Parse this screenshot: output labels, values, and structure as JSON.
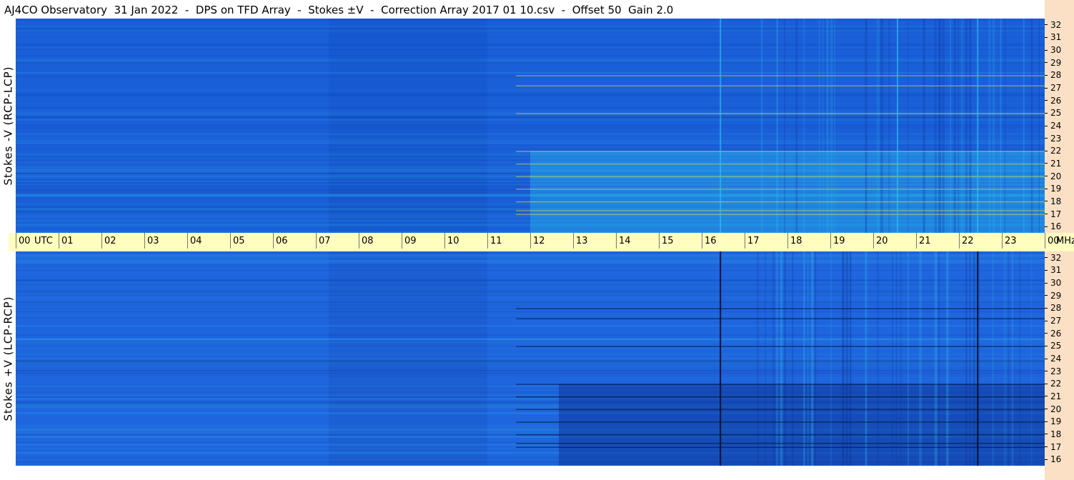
{
  "window": {
    "title": "AJ4CO Observatory  31 Jan 2022  -  DPS on TFD Array  -  Stokes ±V  -  Correction Array 2017 01 10.csv  -  Offset 50  Gain 2.0"
  },
  "chart_data": [
    {
      "type": "heatmap",
      "title": "",
      "ylabel": "Stokes -V (RCP-LCP)",
      "x_unit": "UTC",
      "y_unit": "MHz",
      "xlim": [
        0,
        24
      ],
      "ylim": [
        15.5,
        32.5
      ],
      "x_ticks": [
        "00",
        "01",
        "02",
        "03",
        "04",
        "05",
        "06",
        "07",
        "08",
        "09",
        "10",
        "11",
        "12",
        "13",
        "14",
        "15",
        "16",
        "17",
        "18",
        "19",
        "20",
        "21",
        "22",
        "23",
        "00"
      ],
      "y_ticks": [
        32,
        31,
        30,
        29,
        28,
        27,
        26,
        25,
        24,
        23,
        22,
        21,
        20,
        19,
        18,
        17,
        16
      ],
      "colors": {
        "base": "#1a5fd8",
        "dark": "#0b2f9a",
        "bright": "#2fc8f0",
        "hot": "#f5e63c"
      }
    },
    {
      "type": "heatmap",
      "title": "",
      "ylabel": "Stokes +V (LCP-RCP)",
      "x_unit": "UTC",
      "y_unit": "MHz",
      "xlim": [
        0,
        24
      ],
      "ylim": [
        15.5,
        32.5
      ],
      "x_ticks": [
        "00",
        "01",
        "02",
        "03",
        "04",
        "05",
        "06",
        "07",
        "08",
        "09",
        "10",
        "11",
        "12",
        "13",
        "14",
        "15",
        "16",
        "17",
        "18",
        "19",
        "20",
        "21",
        "22",
        "23",
        "00"
      ],
      "y_ticks": [
        32,
        31,
        30,
        29,
        28,
        27,
        26,
        25,
        24,
        23,
        22,
        21,
        20,
        19,
        18,
        17,
        16
      ],
      "colors": {
        "base": "#1f66de",
        "dark": "#0a2c8c",
        "bright": "#33bdf0",
        "black": "#041030"
      }
    }
  ],
  "axis": {
    "utc_label": "UTC",
    "mhz_label": "MHz"
  }
}
